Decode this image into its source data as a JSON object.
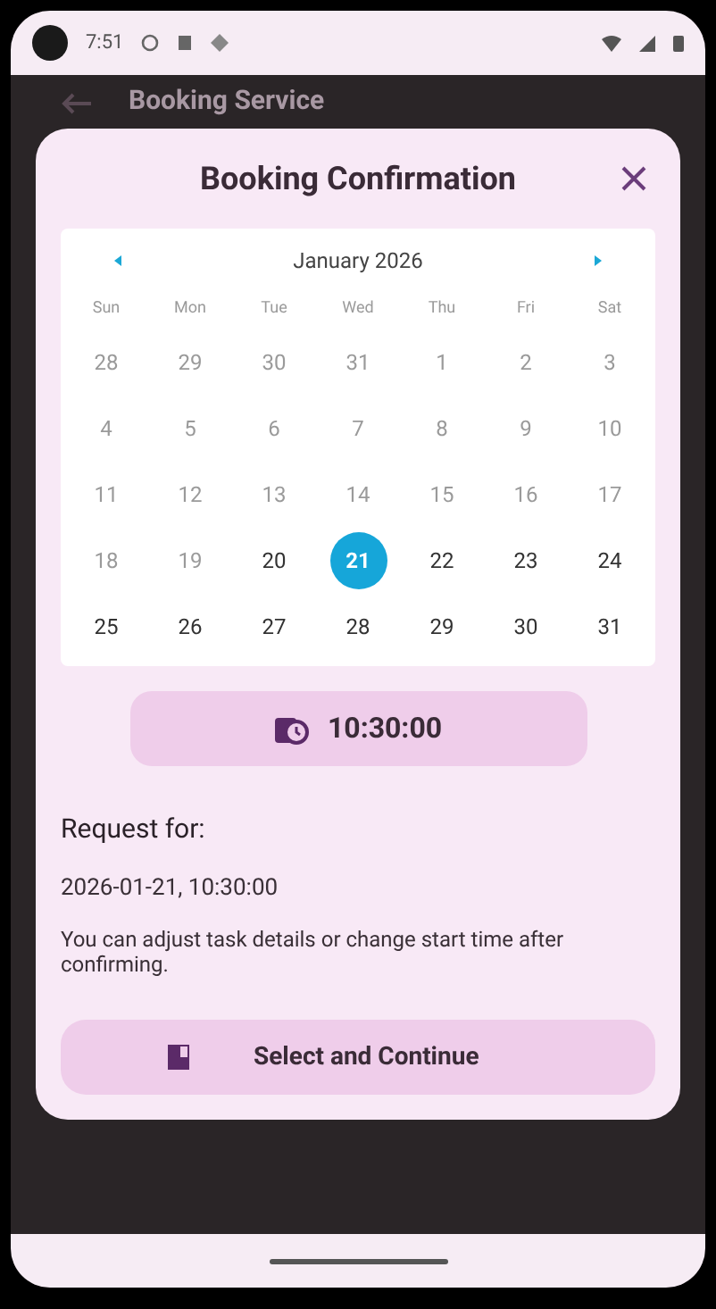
{
  "status_bar": {
    "time": "7:51"
  },
  "background": {
    "title": "Booking Service"
  },
  "dialog": {
    "title": "Booking Confirmation",
    "calendar": {
      "month": "January 2026",
      "weekdays": [
        "Sun",
        "Mon",
        "Tue",
        "Wed",
        "Thu",
        "Fri",
        "Sat"
      ],
      "days": [
        {
          "label": "28",
          "disabled": true,
          "selected": false
        },
        {
          "label": "29",
          "disabled": true,
          "selected": false
        },
        {
          "label": "30",
          "disabled": true,
          "selected": false
        },
        {
          "label": "31",
          "disabled": true,
          "selected": false
        },
        {
          "label": "1",
          "disabled": true,
          "selected": false
        },
        {
          "label": "2",
          "disabled": true,
          "selected": false
        },
        {
          "label": "3",
          "disabled": true,
          "selected": false
        },
        {
          "label": "4",
          "disabled": true,
          "selected": false
        },
        {
          "label": "5",
          "disabled": true,
          "selected": false
        },
        {
          "label": "6",
          "disabled": true,
          "selected": false
        },
        {
          "label": "7",
          "disabled": true,
          "selected": false
        },
        {
          "label": "8",
          "disabled": true,
          "selected": false
        },
        {
          "label": "9",
          "disabled": true,
          "selected": false
        },
        {
          "label": "10",
          "disabled": true,
          "selected": false
        },
        {
          "label": "11",
          "disabled": true,
          "selected": false
        },
        {
          "label": "12",
          "disabled": true,
          "selected": false
        },
        {
          "label": "13",
          "disabled": true,
          "selected": false
        },
        {
          "label": "14",
          "disabled": true,
          "selected": false
        },
        {
          "label": "15",
          "disabled": true,
          "selected": false
        },
        {
          "label": "16",
          "disabled": true,
          "selected": false
        },
        {
          "label": "17",
          "disabled": true,
          "selected": false
        },
        {
          "label": "18",
          "disabled": true,
          "selected": false
        },
        {
          "label": "19",
          "disabled": true,
          "selected": false
        },
        {
          "label": "20",
          "disabled": false,
          "selected": false
        },
        {
          "label": "21",
          "disabled": false,
          "selected": true
        },
        {
          "label": "22",
          "disabled": false,
          "selected": false
        },
        {
          "label": "23",
          "disabled": false,
          "selected": false
        },
        {
          "label": "24",
          "disabled": false,
          "selected": false
        },
        {
          "label": "25",
          "disabled": false,
          "selected": false
        },
        {
          "label": "26",
          "disabled": false,
          "selected": false
        },
        {
          "label": "27",
          "disabled": false,
          "selected": false
        },
        {
          "label": "28",
          "disabled": false,
          "selected": false
        },
        {
          "label": "29",
          "disabled": false,
          "selected": false
        },
        {
          "label": "30",
          "disabled": false,
          "selected": false
        },
        {
          "label": "31",
          "disabled": false,
          "selected": false
        }
      ]
    },
    "time_button": "10:30:00",
    "request_label": "Request for:",
    "request_value": "2026-01-21, 10:30:00",
    "note": "You can adjust task details or change start time after confirming.",
    "confirm_button": "Select and Continue"
  }
}
